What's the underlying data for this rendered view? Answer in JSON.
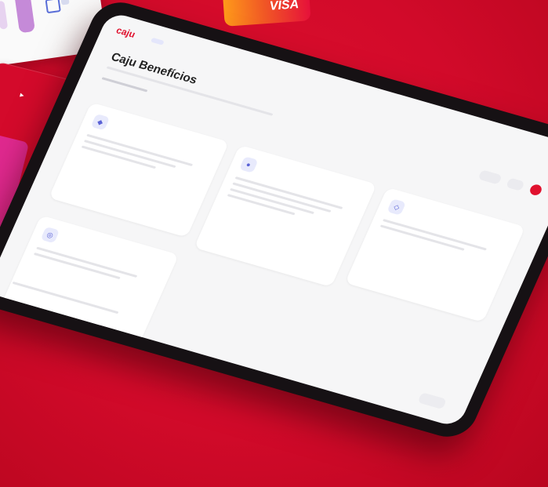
{
  "background": {
    "color": "#d20a2a"
  },
  "card_brand": "VISA",
  "app": {
    "logo": "caju",
    "title": "Caju Benefícios",
    "nav": [
      {
        "label": ""
      },
      {
        "label": ""
      },
      {
        "label": ""
      },
      {
        "label": ""
      },
      {
        "label": ""
      },
      {
        "label": ""
      }
    ],
    "cards": [
      {
        "title": "",
        "link": ""
      },
      {
        "title": "",
        "link": ""
      },
      {
        "title": "",
        "link": ""
      },
      {
        "title": "",
        "link": ""
      },
      {
        "title": "",
        "link": ""
      }
    ]
  }
}
